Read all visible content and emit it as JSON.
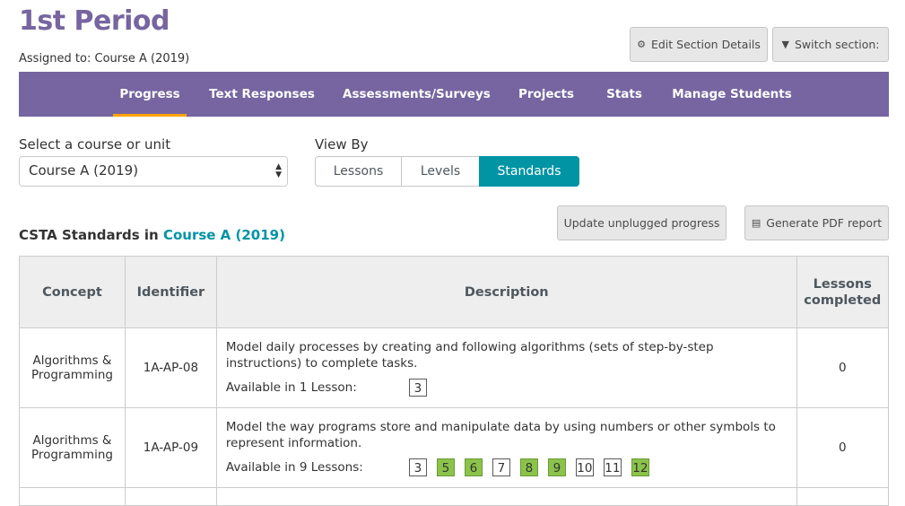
{
  "header": {
    "title": "1st Period",
    "assigned": "Assigned to: Course A (2019)",
    "edit_section": "Edit Section Details",
    "switch_section": "Switch section:"
  },
  "nav": {
    "tabs": [
      "Progress",
      "Text Responses",
      "Assessments/Surveys",
      "Projects",
      "Stats",
      "Manage Students"
    ],
    "active": "Progress"
  },
  "controls": {
    "course_label": "Select a course or unit",
    "course_value": "Course A (2019)",
    "view_by_label": "View By",
    "view_options": [
      "Lessons",
      "Levels",
      "Standards"
    ],
    "view_selected": "Standards",
    "update_unplugged": "Update unplugged progress",
    "generate_pdf": "Generate PDF report"
  },
  "standards": {
    "heading_prefix": "CSTA Standards in",
    "heading_course": "Course A (2019)",
    "columns": [
      "Concept",
      "Identifier",
      "Description",
      "Lessons completed"
    ],
    "rows": [
      {
        "concept": "Algorithms & Programming",
        "identifier": "1A-AP-08",
        "description": "Model daily processes by creating and following algorithms (sets of step-by-step instructions) to complete tasks.",
        "available": "Available in 1 Lesson:",
        "lessons": [
          {
            "n": "3",
            "done": false
          }
        ],
        "completed": "0"
      },
      {
        "concept": "Algorithms & Programming",
        "identifier": "1A-AP-09",
        "description": "Model the way programs store and manipulate data by using numbers or other symbols to represent information.",
        "available": "Available in 9 Lessons:",
        "lessons": [
          {
            "n": "3",
            "done": false
          },
          {
            "n": "5",
            "done": true
          },
          {
            "n": "6",
            "done": true
          },
          {
            "n": "7",
            "done": false
          },
          {
            "n": "8",
            "done": true
          },
          {
            "n": "9",
            "done": true
          },
          {
            "n": "10",
            "done": false
          },
          {
            "n": "11",
            "done": false
          },
          {
            "n": "12",
            "done": true
          }
        ],
        "completed": "0"
      }
    ]
  },
  "colors": {
    "brand_purple": "#7665a0",
    "teal": "#0094a4",
    "active_tab_underline": "#ffa400",
    "lesson_green": "#8bc34a"
  }
}
